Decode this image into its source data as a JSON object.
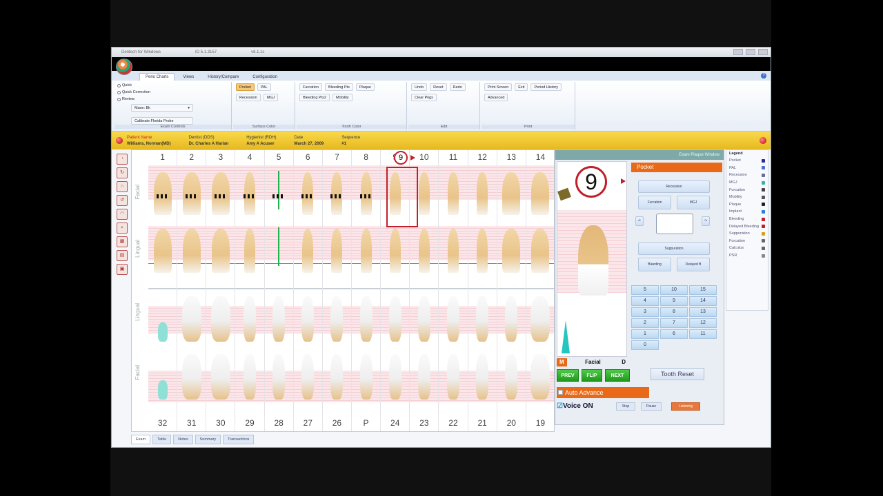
{
  "window": {
    "title": "Dentech for Windows",
    "version_text": "ID 5.1.3157",
    "version_text2": "v8.1.1c"
  },
  "tabs": [
    {
      "label": "Perio Charts",
      "active": true
    },
    {
      "label": "Views",
      "active": false
    },
    {
      "label": "History/Compare",
      "active": false
    },
    {
      "label": "Configuration",
      "active": false
    }
  ],
  "ribbon": {
    "exam_controls": {
      "label": "Exam Controls",
      "radios": [
        "Quick",
        "Quick Correction",
        "Review"
      ],
      "dropdown_value": "Maxe: Bk",
      "calibrate_label": "Calibrate Florida Probe"
    },
    "surface_color": {
      "label": "Surface Color",
      "buttons": [
        "Pocket",
        "PAL",
        "Recession",
        "MGJ"
      ]
    },
    "tooth_color": {
      "label": "Tooth Color",
      "buttons": [
        "Furcation",
        "Bleeding Pts",
        "Plaque",
        "Bleeding Pts2",
        "Mobility"
      ]
    },
    "edit": {
      "label": "Edit",
      "buttons": [
        "Undo",
        "Reset",
        "Redo",
        "Clear Pkgs"
      ]
    },
    "print": {
      "label": "Print",
      "buttons": [
        "Print Screen",
        "Exit",
        "Period History",
        "Advanced"
      ]
    }
  },
  "patient": {
    "name_label": "Patient Name",
    "name": "Williams, Norman(MD)",
    "dentist_label": "Dentist (DDS)",
    "dentist": "Dr. Charles A Harlan",
    "hygienist_label": "Hygienist (RDH)",
    "hygienist": "Amy A Acuser",
    "date_label": "Date",
    "date": "March 27, 2009",
    "sequence_label": "Sequence",
    "sequence": "#1"
  },
  "upper_numbers": [
    "1",
    "2",
    "3",
    "4",
    "5",
    "6",
    "7",
    "8",
    "9",
    "10",
    "11",
    "12",
    "13",
    "14"
  ],
  "lower_numbers": [
    "32",
    "31",
    "30",
    "29",
    "28",
    "27",
    "26",
    "P",
    "24",
    "23",
    "22",
    "21",
    "20",
    "19"
  ],
  "side_labels": {
    "top_facial": "Facial",
    "top_lingual": "Lingual",
    "bottom_lingual": "Lingual",
    "bottom_facial": "Facial"
  },
  "selected_tooth": "9",
  "bottom_tabs": [
    "Exam",
    "Table",
    "Notes",
    "Summary",
    "Transactions"
  ],
  "panel": {
    "header": "Exam Plaque Window",
    "big_number": "9",
    "pocket_label": "Pocket",
    "buttons": {
      "recession": "Recession",
      "furcation": "Furcation",
      "mgj": "MGJ",
      "suppuration": "Suppuration",
      "bleeding": "Bleeding",
      "delayed": "Delayed B"
    },
    "grid": [
      "5",
      "10",
      "15",
      "4",
      "9",
      "14",
      "3",
      "8",
      "13",
      "2",
      "7",
      "12",
      "1",
      "6",
      "11",
      "0"
    ],
    "m": "M",
    "surface": "Facial",
    "d": "D",
    "prev": "PREV",
    "flip": "FLIP",
    "next": "NEXT",
    "tooth_reset": "Tooth Reset",
    "auto_advance": "Auto Advance",
    "voice": "Voice ON",
    "voice_buttons": [
      "Stop",
      "Pause",
      "Listening"
    ]
  },
  "legend": {
    "title": "Legend",
    "items": [
      "Pocket",
      "PAL",
      "Recession",
      "MGJ",
      "Furcation",
      "Mobility",
      "Plaque",
      "Implant",
      "Bleeding",
      "Delayed Bleeding",
      "Suppuration",
      "Furcation",
      "Calculus",
      "PSR"
    ]
  },
  "colors": {
    "accent_orange": "#e86a18",
    "select_red": "#c0202a",
    "patient_bar": "#f0c830",
    "nav_green": "#2aa826"
  }
}
